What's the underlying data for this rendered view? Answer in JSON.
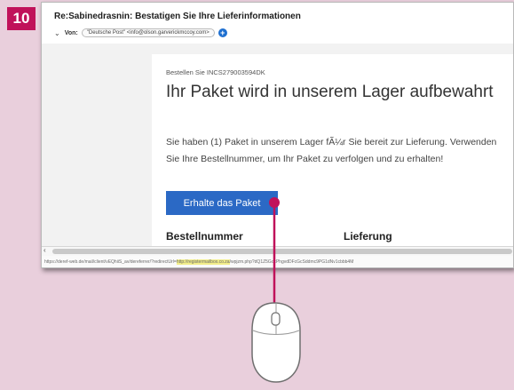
{
  "step_number": "10",
  "email": {
    "subject": "Re:Sabinedrasnin: Bestatigen Sie Ihre Lieferinformationen",
    "from_label": "Von:",
    "from_value": "\"Deutsche Post\" <info@olson.garverickmccoy.com>",
    "order_line": "Bestellen Sie INCS279003594DK",
    "headline": "Ihr Paket wird in unserem Lager aufbewahrt",
    "body_text": "Sie haben (1) Paket in unserem Lager fÃ¼r Sie bereit zur Lieferung. Verwenden Sie Ihre Bestellnummer, um Ihr Paket zu verfolgen und zu erhalten!",
    "cta_label": "Erhalte das Paket",
    "columns": [
      "Bestellnummer",
      "Lieferung"
    ]
  },
  "status_bar": {
    "url_prefix": "https://deref-web.de/mail/client/vEQhiiS_av/dereferrer/?redirectUrl=",
    "url_highlight": "http://registermailbox.co.za",
    "url_suffix": "/wpjzm.php?dQ1Z5GcxPhgvdDFcGcSddmc9PG1dNv1cbbb4M"
  },
  "colors": {
    "badge": "#c0125a",
    "cta": "#2b69c5",
    "pointer_line": "#c0125a"
  },
  "icons": {
    "chevron": "chevron-down-icon",
    "add_contact": "plus-circle-icon",
    "mouse": "mouse-icon"
  }
}
